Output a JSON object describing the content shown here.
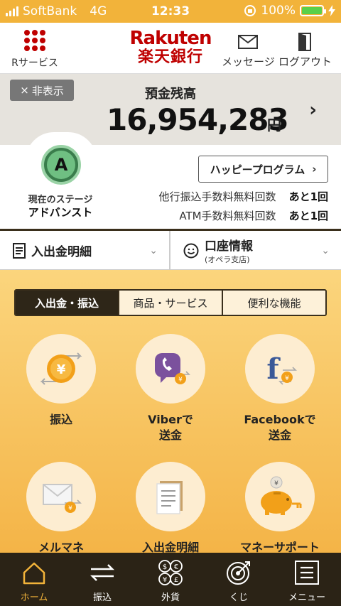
{
  "status_bar": {
    "carrier": "SoftBank",
    "network": "4G",
    "time": "12:33",
    "battery": "100%",
    "battery_color": "#5ad04a"
  },
  "header": {
    "rservice_label": "Rサービス",
    "brand_line1": "Rakuten",
    "brand_line2": "楽天銀行",
    "message_label": "メッセージ",
    "logout_label": "ログアウト",
    "brand_color": "#bf0000"
  },
  "balance": {
    "hide_label": "非表示",
    "label": "預金残高",
    "amount": "16,954,283",
    "unit": "円"
  },
  "stage": {
    "badge_letter": "A",
    "current_label": "現在のステージ",
    "current_value": "アドバンスト",
    "happy_program_label": "ハッピープログラム",
    "transfer_fee_label": "他行振込手数料無料回数",
    "transfer_fee_value": "あと1回",
    "atm_fee_label": "ATM手数料無料回数",
    "atm_fee_value": "あと1回"
  },
  "selectors": {
    "statement_label": "入出金明細",
    "account_label": "口座情報",
    "account_branch": "(オペラ支店)"
  },
  "tabs": [
    {
      "label": "入出金・振込",
      "active": true
    },
    {
      "label": "商品・サービス",
      "active": false
    },
    {
      "label": "便利な機能",
      "active": false
    }
  ],
  "features": [
    {
      "label": "振込",
      "icon": "yen-coin-transfer-icon"
    },
    {
      "label": "Viberで\n送金",
      "icon": "viber-transfer-icon"
    },
    {
      "label": "Facebookで\n送金",
      "icon": "facebook-transfer-icon"
    },
    {
      "label": "メルマネ",
      "icon": "mail-money-icon"
    },
    {
      "label": "入出金明細",
      "icon": "statement-document-icon"
    },
    {
      "label": "マネーサポート",
      "icon": "piggy-bank-icon"
    }
  ],
  "tabbar": [
    {
      "label": "ホーム",
      "icon": "home-icon",
      "active": true
    },
    {
      "label": "振込",
      "icon": "transfer-arrows-icon",
      "active": false
    },
    {
      "label": "外貨",
      "icon": "currency-icon",
      "active": false
    },
    {
      "label": "くじ",
      "icon": "target-icon",
      "active": false
    },
    {
      "label": "メニュー",
      "icon": "menu-icon",
      "active": false
    }
  ],
  "colors": {
    "accent": "#f2b33a",
    "dark": "#2b2316"
  }
}
